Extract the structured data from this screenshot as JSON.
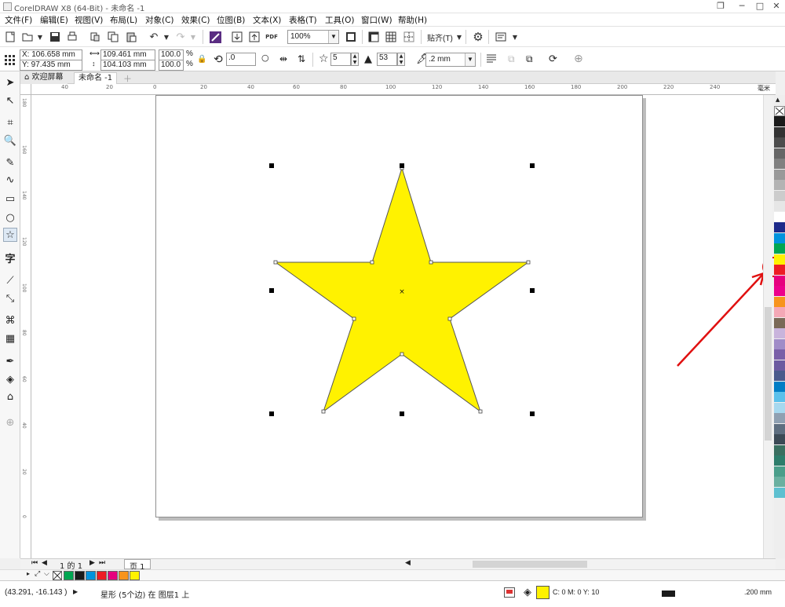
{
  "app": {
    "title": "CorelDRAW X8 (64-Bit) - 未命名 -1",
    "window_controls": {
      "restore": "❐",
      "minimize": "─",
      "maximize": "□",
      "close": "✕"
    }
  },
  "menu": [
    "文件(F)",
    "编辑(E)",
    "视图(V)",
    "布局(L)",
    "对象(C)",
    "效果(C)",
    "位图(B)",
    "文本(X)",
    "表格(T)",
    "工具(O)",
    "窗口(W)",
    "帮助(H)"
  ],
  "toolbar": {
    "zoom": "100%",
    "snap_label": "贴齐(T)",
    "pdf_label": "PDF"
  },
  "property_bar": {
    "x": "X: 106.658 mm",
    "y": "Y: 97.435 mm",
    "width": "109.461 mm",
    "height": "104.103 mm",
    "scale_x": "100.0",
    "scale_y": "100.0",
    "percent": "%",
    "rotation": ".0",
    "points": "5",
    "sharpness": "53",
    "outline": ".2 mm"
  },
  "tabs": {
    "welcome": "欢迎屏幕",
    "document": "未命名 -1"
  },
  "ruler": {
    "units": "毫米",
    "h_ticks": [
      "40",
      "20",
      "0",
      "20",
      "40",
      "60",
      "80",
      "100",
      "120",
      "140",
      "160",
      "180",
      "200",
      "220",
      "240"
    ],
    "v_ticks": [
      "180",
      "160",
      "140",
      "120",
      "100",
      "80",
      "60",
      "40",
      "20",
      "0"
    ]
  },
  "star": {
    "fill": "#fff200",
    "outline": "#555555",
    "points": 5
  },
  "palette_colors": [
    "#1a1a1a",
    "#333333",
    "#4d4d4d",
    "#666666",
    "#808080",
    "#999999",
    "#b3b3b3",
    "#cccccc",
    "#e6e6e6",
    "#ffffff",
    "#1d2a8a",
    "#0093dd",
    "#00a651",
    "#fff200",
    "#ed1c24",
    "#e6007e",
    "#ec008c",
    "#f7941d",
    "#f4a8b6",
    "#7b6a58",
    "#c9b4dc",
    "#a08cc8",
    "#7a5fa8",
    "#6c5aa0",
    "#4a5a8c",
    "#007dc5",
    "#5bc0eb",
    "#a6d8ef",
    "#8fa0b2",
    "#5e6e80",
    "#3c4a56",
    "#3a6f60",
    "#2d7d6b",
    "#4a9e8a",
    "#6ab0a0",
    "#5ec0d0"
  ],
  "page_nav": {
    "page_count": "1 的 1",
    "page_tab": "页 1"
  },
  "doc_palette": [
    "#00a651",
    "#1a1a1a",
    "#0093dd",
    "#ed1c24",
    "#e6007e",
    "#f7941d",
    "#fff200"
  ],
  "status": {
    "coords": "(43.291, -16.143 )",
    "object_info": "星形 (5个边) 在 图层1 上",
    "fill_info": "C: 0 M: 0 Y: 10",
    "outline_width": ".200 mm"
  },
  "colors": {
    "arrow": "#e01010",
    "accent_yellow": "#fff200"
  }
}
